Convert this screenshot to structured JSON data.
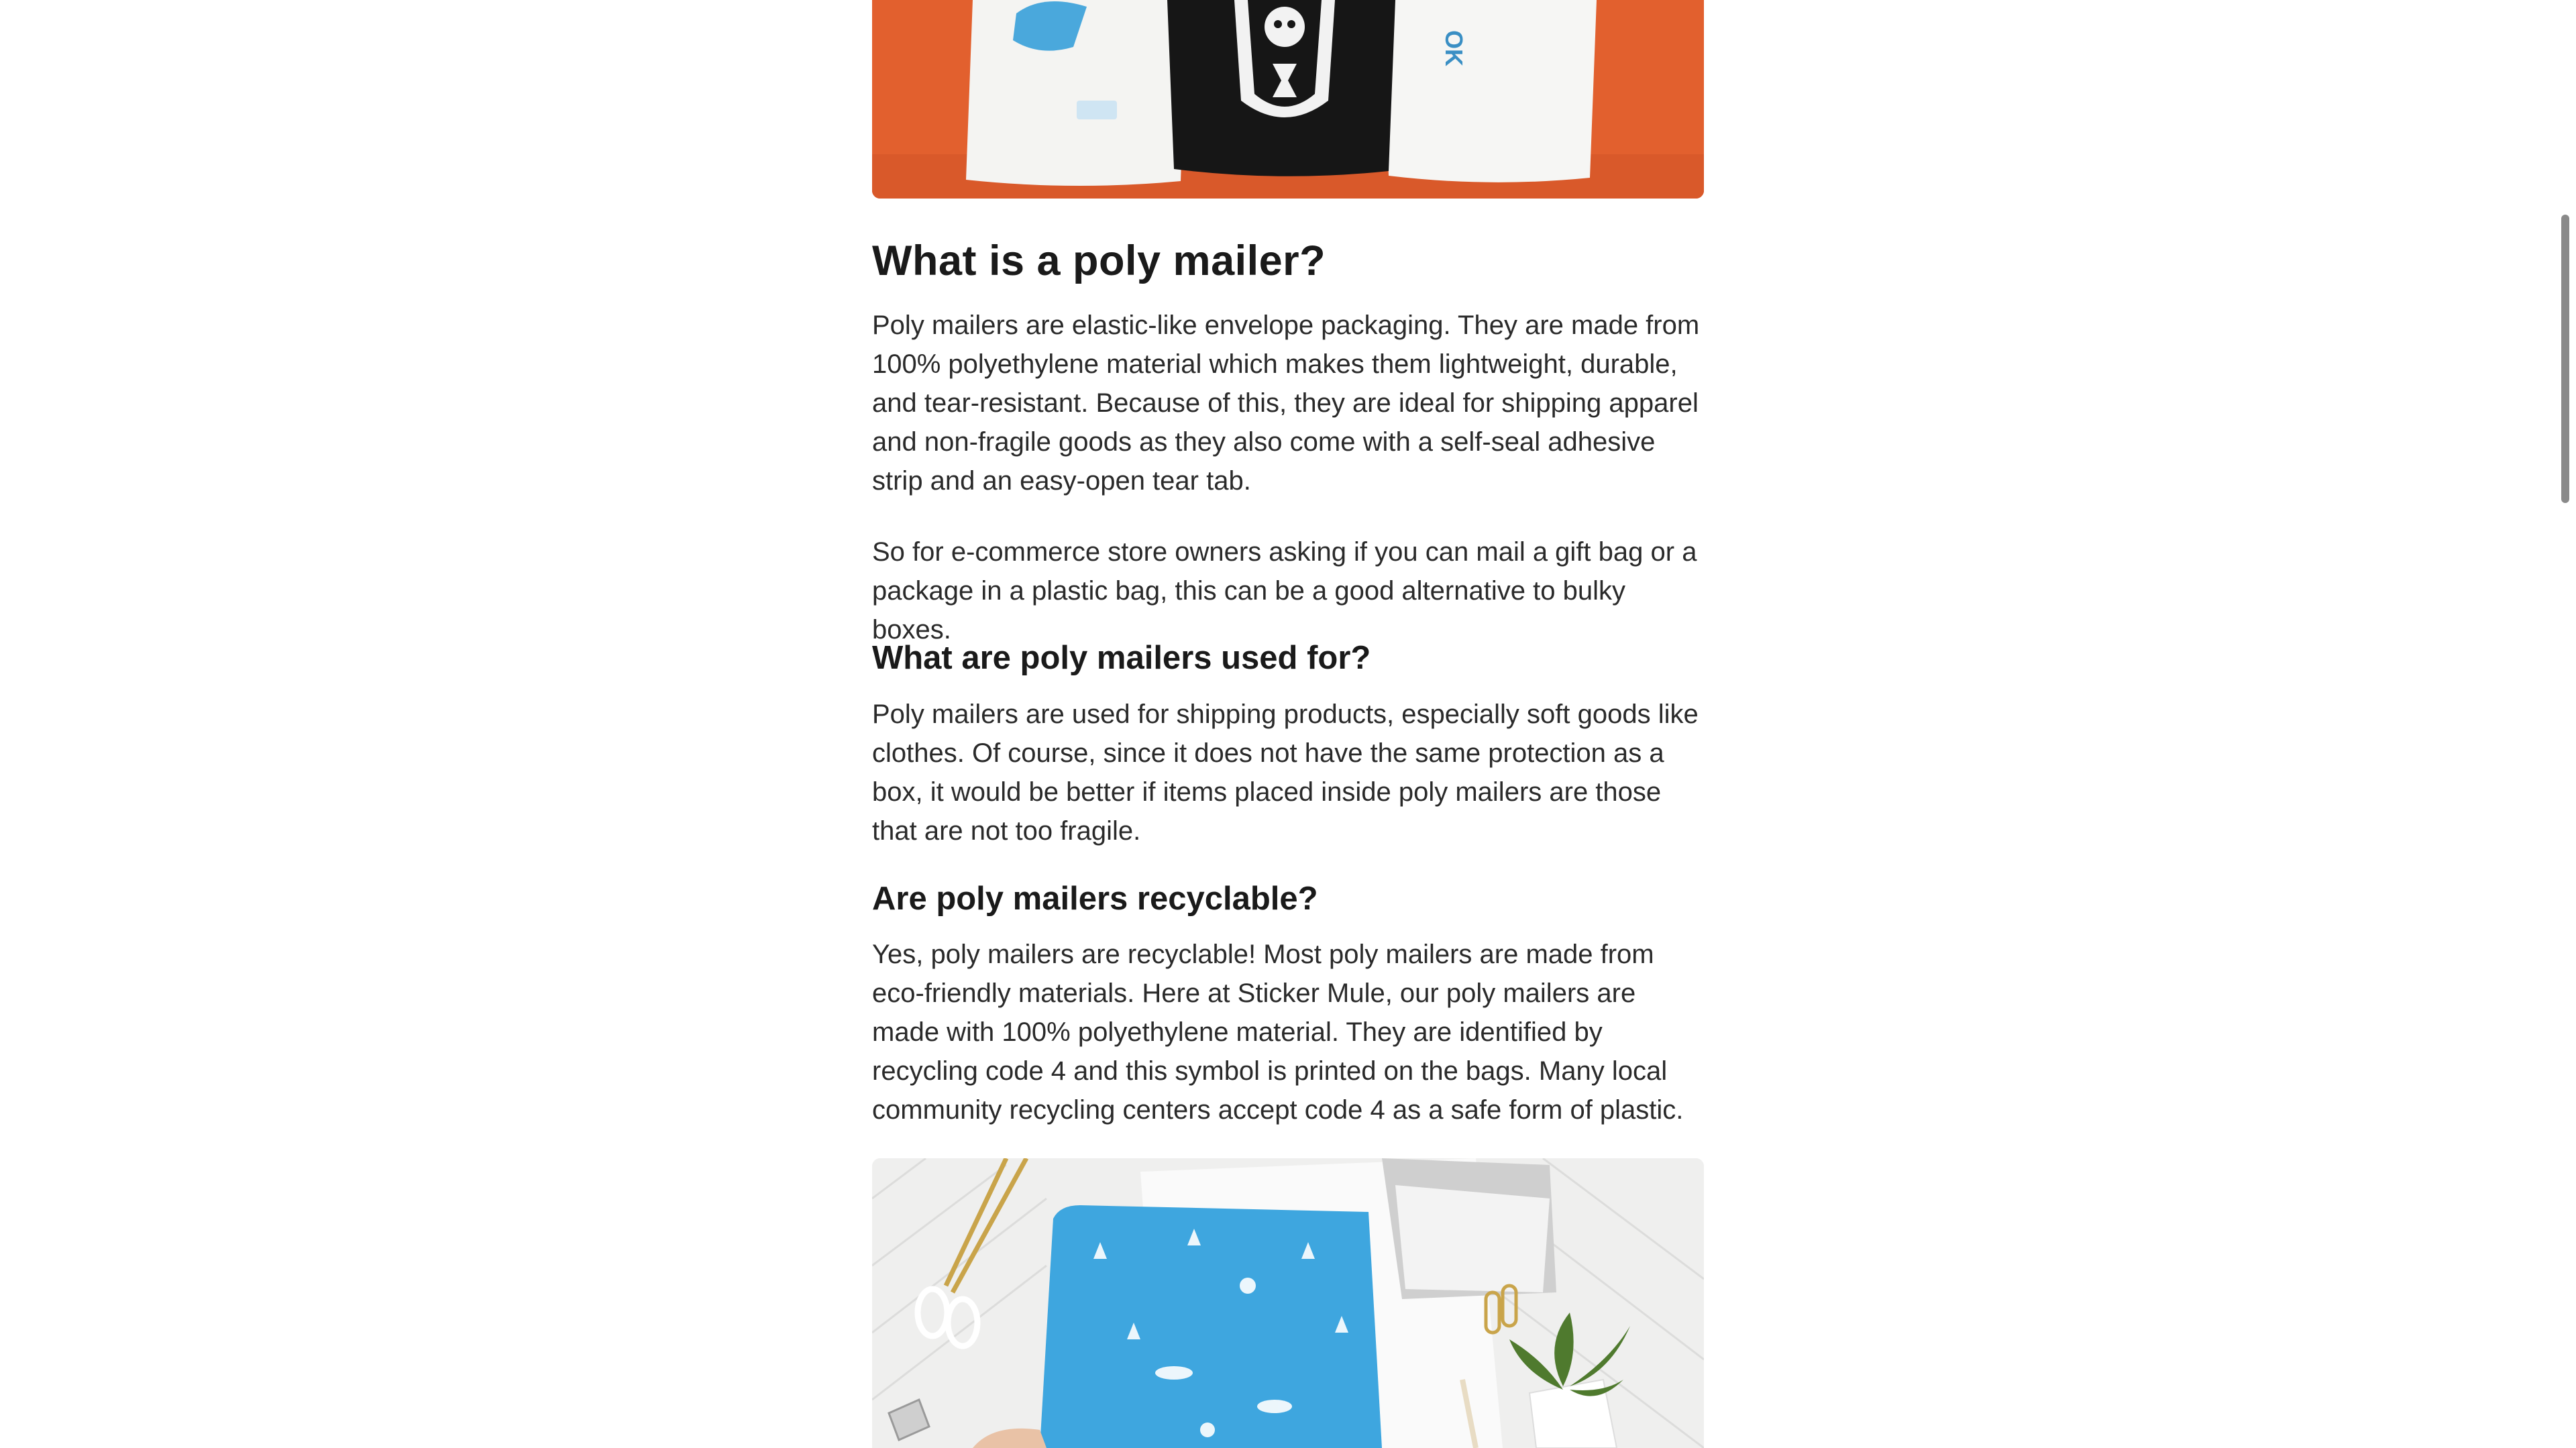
{
  "article": {
    "heading_main": "What is a poly mailer?",
    "para_1": "Poly mailers are elastic-like envelope packaging. They are made from 100% polyethylene material which makes them lightweight, durable, and tear-resistant. Because of this, they are ideal for shipping apparel and non-fragile goods as they also come with a self-seal adhesive strip and an easy-open tear tab.",
    "para_2": "So for e-commerce store owners asking if you can mail a gift bag or a package in a plastic bag, this can be a good alternative to bulky boxes.",
    "heading_used_for": "What are poly mailers used for?",
    "para_3": "Poly mailers are used for shipping products, especially soft goods like clothes. Of course, since it does not have the same protection as a box, it would be better if items placed inside poly mailers are those that are not too fragile.",
    "heading_recyclable": "Are poly mailers recyclable?",
    "para_4": "Yes, poly mailers are recyclable! Most poly mailers are made from eco-friendly materials. Here at Sticker Mule, our poly mailers are made with 100% polyethylene material. They are identified by recycling code 4 and this symbol is printed on the bags. Many local community recycling centers accept code 4 as a safe form of plastic."
  },
  "images": {
    "top_background": "#e2602e",
    "bottom_background": "#efefee",
    "mailer_blue": "#3ea6df"
  }
}
